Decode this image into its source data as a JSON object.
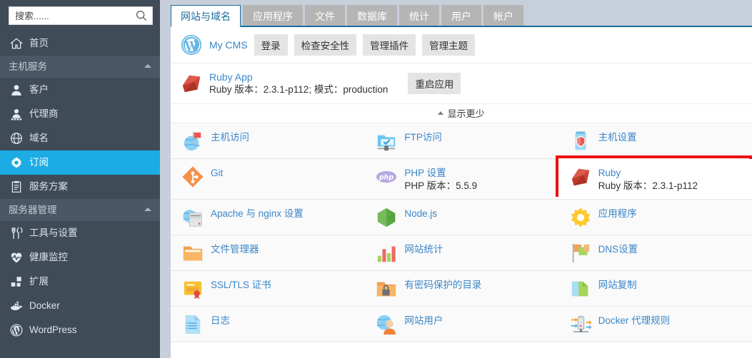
{
  "colors": {
    "sidebar_bg": "#3f4b57",
    "sidebar_group_bg": "#4a5764",
    "selected": "#1cabe2",
    "link": "#3b86c8",
    "tab_active_border": "#1a6d9e",
    "highlight_box": "#ee1111"
  },
  "search": {
    "placeholder": "搜索......",
    "value": "",
    "icon": "search-icon"
  },
  "sidebar": {
    "items": [
      {
        "type": "item",
        "label": "首页",
        "icon": "home-icon",
        "selected": false
      },
      {
        "type": "group",
        "label": "主机服务",
        "icon": "chevron-up-icon"
      },
      {
        "type": "item",
        "label": "客户",
        "icon": "user-icon",
        "selected": false
      },
      {
        "type": "item",
        "label": "代理商",
        "icon": "reseller-icon",
        "selected": false
      },
      {
        "type": "item",
        "label": "域名",
        "icon": "globe-icon",
        "selected": false
      },
      {
        "type": "item",
        "label": "订阅",
        "icon": "gear-icon",
        "selected": true
      },
      {
        "type": "item",
        "label": "服务方案",
        "icon": "clipboard-icon",
        "selected": false
      },
      {
        "type": "group",
        "label": "服务器管理",
        "icon": "chevron-up-icon"
      },
      {
        "type": "item",
        "label": "工具与设置",
        "icon": "tools-icon",
        "selected": false
      },
      {
        "type": "item",
        "label": "健康监控",
        "icon": "heartbeat-icon",
        "selected": false
      },
      {
        "type": "item",
        "label": "扩展",
        "icon": "extensions-icon",
        "selected": false
      },
      {
        "type": "item",
        "label": "Docker",
        "icon": "docker-icon",
        "selected": false
      },
      {
        "type": "item",
        "label": "WordPress",
        "icon": "wordpress-icon",
        "selected": false
      }
    ]
  },
  "tabs": [
    {
      "label": "网站与域名",
      "active": true
    },
    {
      "label": "应用程序",
      "active": false
    },
    {
      "label": "文件",
      "active": false
    },
    {
      "label": "数据库",
      "active": false
    },
    {
      "label": "统计",
      "active": false
    },
    {
      "label": "用户",
      "active": false
    },
    {
      "label": "帐户",
      "active": false
    }
  ],
  "apps": {
    "cms": {
      "icon": "wordpress-icon",
      "name": "My CMS",
      "buttons": [
        "登录",
        "检查安全性",
        "管理插件",
        "管理主题"
      ]
    },
    "ruby": {
      "icon": "ruby-icon",
      "name": "Ruby App",
      "meta": "Ruby 版本：2.3.1-p112; 模式：production",
      "button": "重启应用"
    },
    "show_less": "显示更少"
  },
  "grid": {
    "rows": [
      [
        {
          "icon": "hosting-access-icon",
          "label": "主机访问",
          "sub": ""
        },
        {
          "icon": "ftp-access-icon",
          "label": "FTP访问",
          "sub": ""
        },
        {
          "icon": "hosting-settings-icon",
          "label": "主机设置",
          "sub": ""
        }
      ],
      [
        {
          "icon": "git-icon",
          "label": "Git",
          "sub": ""
        },
        {
          "icon": "php-icon",
          "label": "PHP 设置",
          "sub": "PHP 版本：5.5.9"
        },
        {
          "icon": "ruby-icon",
          "label": "Ruby",
          "sub": "Ruby 版本：2.3.1-p112",
          "highlighted": true
        }
      ],
      [
        {
          "icon": "apache-nginx-icon",
          "label": "Apache 与 nginx 设置",
          "sub": ""
        },
        {
          "icon": "nodejs-icon",
          "label": "Node.js",
          "sub": ""
        },
        {
          "icon": "applications-icon",
          "label": "应用程序",
          "sub": ""
        }
      ],
      [
        {
          "icon": "file-manager-icon",
          "label": "文件管理器",
          "sub": ""
        },
        {
          "icon": "web-statistics-icon",
          "label": "网站统计",
          "sub": ""
        },
        {
          "icon": "dns-settings-icon",
          "label": "DNS设置",
          "sub": ""
        }
      ],
      [
        {
          "icon": "ssl-certificate-icon",
          "label": "SSL/TLS 证书",
          "sub": ""
        },
        {
          "icon": "protected-directory-icon",
          "label": "有密码保护的目录",
          "sub": ""
        },
        {
          "icon": "website-copy-icon",
          "label": "网站复制",
          "sub": ""
        }
      ],
      [
        {
          "icon": "logs-icon",
          "label": "日志",
          "sub": ""
        },
        {
          "icon": "web-users-icon",
          "label": "网站用户",
          "sub": ""
        },
        {
          "icon": "docker-proxy-icon",
          "label": "Docker 代理规则",
          "sub": ""
        }
      ]
    ]
  }
}
